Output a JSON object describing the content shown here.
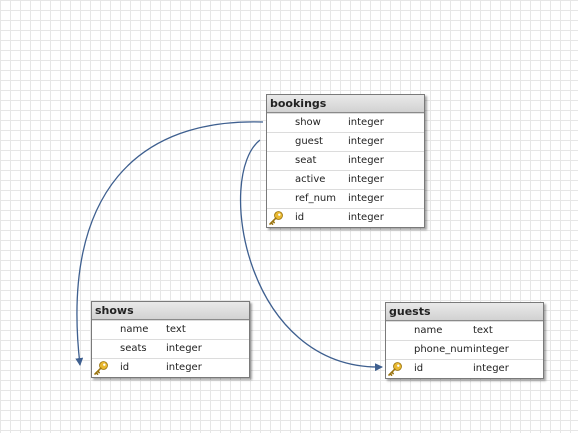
{
  "tables": [
    {
      "id": "bookings",
      "title": "bookings",
      "columns": [
        {
          "name": "show",
          "type": "integer",
          "primary_key": false
        },
        {
          "name": "guest",
          "type": "integer",
          "primary_key": false
        },
        {
          "name": "seat",
          "type": "integer",
          "primary_key": false
        },
        {
          "name": "active",
          "type": "integer",
          "primary_key": false
        },
        {
          "name": "ref_num",
          "type": "integer",
          "primary_key": false
        },
        {
          "name": "id",
          "type": "integer",
          "primary_key": true
        }
      ]
    },
    {
      "id": "shows",
      "title": "shows",
      "columns": [
        {
          "name": "name",
          "type": "text",
          "primary_key": false
        },
        {
          "name": "seats",
          "type": "integer",
          "primary_key": false
        },
        {
          "name": "id",
          "type": "integer",
          "primary_key": true
        }
      ]
    },
    {
      "id": "guests",
      "title": "guests",
      "columns": [
        {
          "name": "name",
          "type": "text",
          "primary_key": false
        },
        {
          "name": "phone_num",
          "type": "integer",
          "primary_key": false
        },
        {
          "name": "id",
          "type": "integer",
          "primary_key": true
        }
      ]
    }
  ],
  "relations": [
    {
      "from_table": "bookings",
      "from_column": "show",
      "to_table": "shows",
      "to_column": "id"
    },
    {
      "from_table": "bookings",
      "from_column": "guest",
      "to_table": "guests",
      "to_column": "id"
    }
  ],
  "colors": {
    "connector": "#3e5f8f",
    "grid": "#e6e6e6",
    "key_icon": "#e8b830"
  },
  "icons": {
    "primary_key": "key-icon"
  }
}
